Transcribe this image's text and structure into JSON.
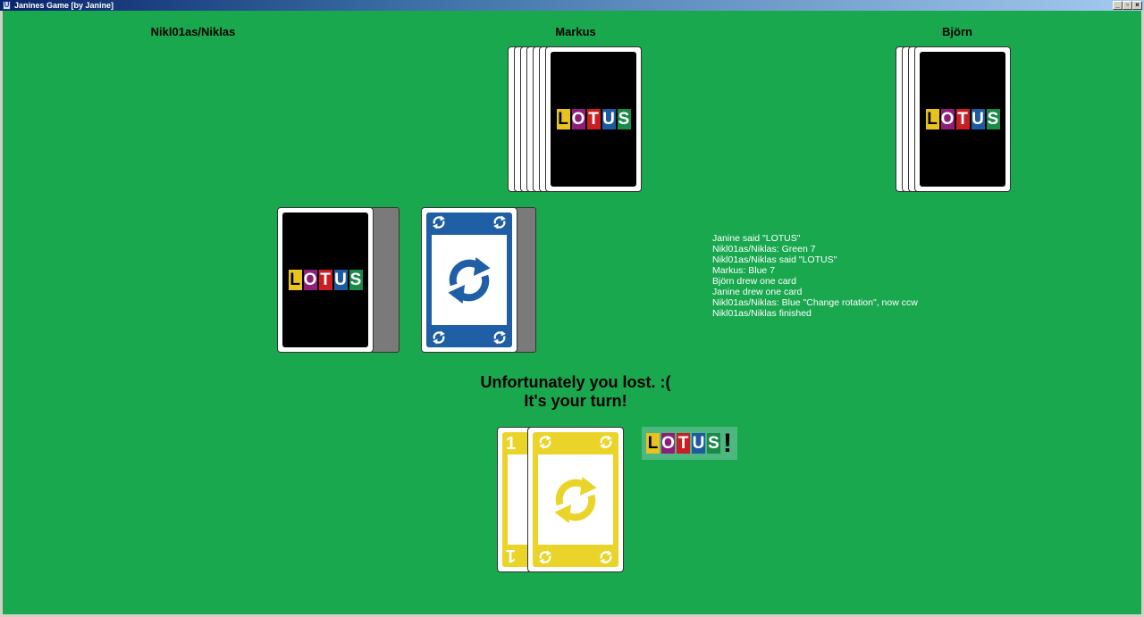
{
  "window": {
    "title": "Janines Game [by Janine]",
    "icon": "U",
    "minimize_label": "_",
    "maximize_label": "▫",
    "close_label": "×"
  },
  "players": {
    "left": {
      "name": "Nikl01as/Niklas",
      "cards": 0
    },
    "top": {
      "name": "Markus",
      "cards": 7
    },
    "right": {
      "name": "Björn",
      "cards": 4
    }
  },
  "logo_letters": [
    {
      "char": "L",
      "color": "#e8c21e",
      "text_color": "#000000"
    },
    {
      "char": "O",
      "color": "#8e1e7a",
      "text_color": "#ffffff"
    },
    {
      "char": "T",
      "color": "#c81e24",
      "text_color": "#ffffff"
    },
    {
      "char": "U",
      "color": "#1e5aa0",
      "text_color": "#ffffff"
    },
    {
      "char": "S",
      "color": "#1a8a48",
      "text_color": "#ffffff"
    }
  ],
  "discard_card": {
    "color": "Blue",
    "hex": "#1e5fa5",
    "type": "Change rotation",
    "icon": "rotation-icon"
  },
  "log": [
    "Janine said \"LOTUS\"",
    "Nikl01as/Niklas: Green 7",
    "Nikl01as/Niklas said \"LOTUS\"",
    "Markus: Blue 7",
    "Björn drew one card",
    "Janine drew one card",
    "Nikl01as/Niklas: Blue \"Change rotation\", now ccw",
    "Nikl01as/Niklas finished"
  ],
  "status": {
    "line1": "Unfortunately you lost. :(",
    "line2": "It's your turn!"
  },
  "hand": [
    {
      "color": "Yellow",
      "hex": "#ebd42a",
      "value": "1"
    },
    {
      "color": "Yellow",
      "hex": "#ebd42a",
      "type": "Change rotation",
      "icon": "rotation-icon"
    }
  ],
  "lotus_button": {
    "exclamation": "!"
  },
  "colors": {
    "table": "#1aa84f",
    "card_back": "#000000"
  }
}
